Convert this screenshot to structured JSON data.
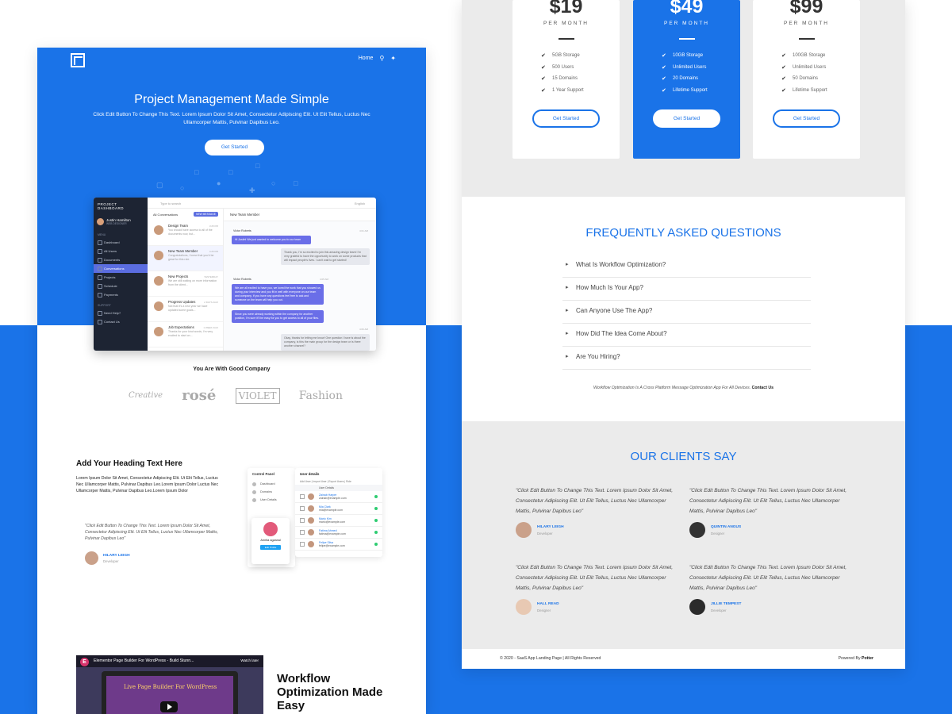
{
  "left": {
    "nav": {
      "home": "Home",
      "search_icon": "search-icon",
      "twitter_icon": "twitter-icon"
    },
    "hero": {
      "title": "Project Management Made Simple",
      "text": "Click Edit Button To Change This Text. Lorem Ipsum Dolor Sit Amet, Consectetur Adipiscing Elit. Ut Elit Tellus, Luctus Nec Ullamcorper Mattis, Pulvinar Dapibus Leo.",
      "cta": "Get Started"
    },
    "dashboard": {
      "title": "PROJECT DASHBOARD",
      "user_name": "Justin Hamilton",
      "user_role": "WEB DESIGNER",
      "menu_label": "MENU",
      "menu": [
        "Dashboard",
        "All Users",
        "Documents",
        "Conversations",
        "Projects",
        "Schedule",
        "Payments"
      ],
      "support_label": "SUPPORT",
      "support": [
        "Need Help?",
        "Contact Us"
      ],
      "search_placeholder": "Type to search",
      "language": "English",
      "list_header": "All Conversations",
      "new_message": "NEW MESSAGE",
      "conversations": [
        {
          "name": "Design Team",
          "msg": "You should have access to all of the documents now, but...",
          "time": "3:25 PM"
        },
        {
          "name": "New Team Member",
          "msg": "Congratulations, I knew that you'd be great for this role.",
          "time": "4:25 PM"
        },
        {
          "name": "New Projects",
          "msg": "We are still waiting on more information from the client...",
          "time": "YESTERDAY"
        },
        {
          "name": "Progress Updates",
          "msg": "Not that it's a new year we have updated some goals...",
          "time": "2 DAYS AGO"
        },
        {
          "name": "Job Expectations",
          "msg": "Thanks for your kind words, I'm very excited to start on...",
          "time": "1 WEEK AGO"
        }
      ],
      "chat_header": "New Team Member",
      "sender": "Victor Roberts",
      "messages": [
        "Hi Justin! We just wanted to welcome you to our team",
        "Thank you, I'm so excited to join this amazing design team! I'm very grateful to have the opportunity to work on some products that will impact people's lives. I can't wait to get started!",
        "We are all excited to have you, we loved the work that you showed us during your interview and you fit in well with everyone on our team and company. If you have any questions feel free to ask and someone on the team will help you out.",
        "Since you were already working within the company for another position, I'm sure it'll be easy for you to get access to all of your files.",
        "Okay, thanks for letting me know! One question I have is about the company, is this the main group for the design team or is there another channel?"
      ],
      "times": [
        "4:01 AM",
        "4:05 AM",
        "4:06 AM",
        "4:10 AM"
      ]
    },
    "company": {
      "title": "You Are With Good Company",
      "logos": [
        "Creative",
        "rosé",
        "VIOLET",
        "Fashion"
      ]
    },
    "feature": {
      "heading": "Add Your Heading Text Here",
      "text": "Lorem Ipsum Dolor Sit Amet, Consectetur Adipiscing Elit. Ut Elit Tellus, Luctus Nec Ullamcorper Mattis, Pulvinar Dapibus Leo.Lorem Ipsum Dolor Luctus Nec Ullamcorper Mattis, Pulvinar Dapibus Leo.Lorem Ipsum Dolor",
      "quote": "\"Click Edit Button To Change This Text. Lorem Ipsum Dolor Sit Amet, Consectetur Adipiscing Elit. Ut Elit Tellus, Luctus Nec Ullamcorper Mattis, Pulvinar Dapibus Leo\"",
      "author": "HILARY LEIGH",
      "role": "Developer",
      "control_panel": {
        "title": "Control Panel",
        "items": [
          "Dashboard",
          "Domains",
          "User Details"
        ]
      },
      "profile": {
        "name": "Amrita agarwal",
        "button": "Edit Profile"
      },
      "user_details": {
        "title": "User details",
        "tabs": "Add User | Import User | Export Users | Role",
        "column": "User Details",
        "users": [
          {
            "name": "Zainab Harper",
            "email": "zainab@example.com"
          },
          {
            "name": "Mia Clark",
            "email": "mia@example.com"
          },
          {
            "name": "Mario Kim",
            "email": "mario@example.com"
          },
          {
            "name": "Fatima Ahmed",
            "email": "fatima@example.com"
          },
          {
            "name": "Felipe Silva",
            "email": "felipe@example.com"
          }
        ]
      }
    },
    "video": {
      "title": "Elementor Page Builder For WordPress - Build Stunn...",
      "watch_later": "Watch later",
      "screen_text": "Live Page Builder For WordPress"
    },
    "workflow": "Workflow Optimization Made Easy"
  },
  "right": {
    "plans": [
      {
        "price": "$19",
        "period": "PER MONTH",
        "features": [
          "5GB Storage",
          "500 Users",
          "15 Domains",
          "1 Year Support"
        ],
        "cta": "Get Started"
      },
      {
        "price": "$49",
        "period": "PER MONTH",
        "features": [
          "10GB Storage",
          "Unlimited Users",
          "20 Domains",
          "Lifetime Support"
        ],
        "cta": "Get Started"
      },
      {
        "price": "$99",
        "period": "PER MONTH",
        "features": [
          "100GB Storage",
          "Unlimited Users",
          "50 Domains",
          "Lifetime Support"
        ],
        "cta": "Get Started"
      }
    ],
    "faq": {
      "title": "FREQUENTLY ASKED QUESTIONS",
      "questions": [
        "What Is Workflow Optimization?",
        "How Much Is Your App?",
        "Can Anyone Use The App?",
        "How Did The Idea Come About?",
        "Are You Hiring?"
      ],
      "note": "Workflow Optimization Is A Cross Platform Message Optimization App For All Devices.",
      "contact": "Contact Us"
    },
    "clients": {
      "title": "OUR CLIENTS SAY",
      "testimonials": [
        {
          "quote": "\"Click Edit Button To Change This Text. Lorem Ipsum Dolor Sit Amet, Consectetur Adipiscing Elit. Ut Elit Tellus, Luctus Nec Ullamcorper Mattis, Pulvinar Dapibus Leo\"",
          "name": "HILARY LEIGH",
          "role": "Developer"
        },
        {
          "quote": "\"Click Edit Button To Change This Text. Lorem Ipsum Dolor Sit Amet, Consectetur Adipiscing Elit. Ut Elit Tellus, Luctus Nec Ullamcorper Mattis, Pulvinar Dapibus Leo\"",
          "name": "QUINTIN ANGUS",
          "role": "Designer"
        },
        {
          "quote": "\"Click Edit Button To Change This Text. Lorem Ipsum Dolor Sit Amet, Consectetur Adipiscing Elit. Ut Elit Tellus, Luctus Nec Ullamcorper Mattis, Pulvinar Dapibus Leo\"",
          "name": "HALL READ",
          "role": "Designer"
        },
        {
          "quote": "\"Click Edit Button To Change This Text. Lorem Ipsum Dolor Sit Amet, Consectetur Adipiscing Elit. Ut Elit Tellus, Luctus Nec Ullamcorper Mattis, Pulvinar Dapibus Leo\"",
          "name": "JILLIE TEMPEST",
          "role": "Developer"
        }
      ]
    },
    "footer": {
      "copyright": "© 2020 - SaaS App Landing Page | All Rights Reserved",
      "powered_prefix": "Powered By",
      "powered_by": "Potter"
    }
  },
  "colors": {
    "brand_blue": "#1a73e8",
    "light_gray": "#ebebeb",
    "dark_sidebar": "#1d2433"
  }
}
